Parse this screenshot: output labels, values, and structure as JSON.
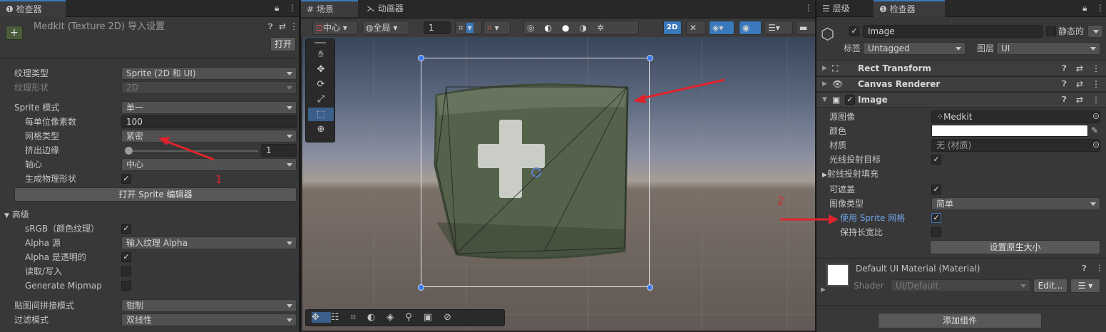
{
  "inspector_left": {
    "tab": "检查器",
    "title": "Medkit (Texture 2D) 导入设置",
    "open_button": "打开",
    "rows": [
      {
        "label": "纹理类型",
        "value": "Sprite (2D 和 UI)"
      },
      {
        "label": "纹理形状",
        "value": "2D"
      },
      {
        "label": "Sprite 模式",
        "value": "单一"
      },
      {
        "label": "每单位像素数",
        "value": "100"
      },
      {
        "label": "网格类型",
        "value": "紧密"
      },
      {
        "label": "挤出边缘",
        "value": "1"
      },
      {
        "label": "轴心",
        "value": "中心"
      },
      {
        "label": "生成物理形状"
      }
    ],
    "sprite_editor_button": "打开 Sprite 编辑器",
    "advanced": {
      "header": "高级",
      "rows": [
        {
          "label": "sRGB（颜色纹理）"
        },
        {
          "label": "Alpha 源",
          "value": "输入纹理 Alpha"
        },
        {
          "label": "Alpha 是透明的"
        },
        {
          "label": "读取/写入"
        },
        {
          "label": "Generate Mipmap"
        }
      ]
    },
    "wrap_label": "贴图间拼接模式",
    "wrap_value": "钳制",
    "filter_label": "过滤模式",
    "filter_value": "双线性",
    "annotation": "1"
  },
  "scene": {
    "tabs": [
      "场景",
      "动画器"
    ],
    "toolbar": {
      "pivot": "中心",
      "space": "全局",
      "snap_value": "1",
      "mode_2d": "2D"
    }
  },
  "inspector_right": {
    "tabs": [
      "层级",
      "检查器"
    ],
    "object_name": "Image",
    "static_label": "静态的",
    "tag_label": "标签",
    "tag_value": "Untagged",
    "layer_label": "图层",
    "layer_value": "UI",
    "components": [
      "Rect Transform",
      "Canvas Renderer",
      "Image"
    ],
    "image_props": [
      {
        "label": "源图像",
        "value": "Medkit"
      },
      {
        "label": "颜色",
        "value": ""
      },
      {
        "label": "材质",
        "value": "无 (材质)"
      },
      {
        "label": "光线投射目标"
      },
      {
        "label": "射线投射填充"
      },
      {
        "label": "可遮盖"
      },
      {
        "label": "图像类型",
        "value": "简单"
      },
      {
        "label": "使用 Sprite 网格"
      },
      {
        "label": "保持长宽比"
      }
    ],
    "native_size_button": "设置原生大小",
    "material_name": "Default UI Material (Material)",
    "shader_label": "Shader",
    "shader_value": "UI/Default",
    "edit_button": "Edit...",
    "add_component_button": "添加组件",
    "annotation": "2"
  },
  "colors": {
    "accent": "#3a79bb",
    "annotation_red": "#e0232b",
    "panel": "#383838"
  }
}
